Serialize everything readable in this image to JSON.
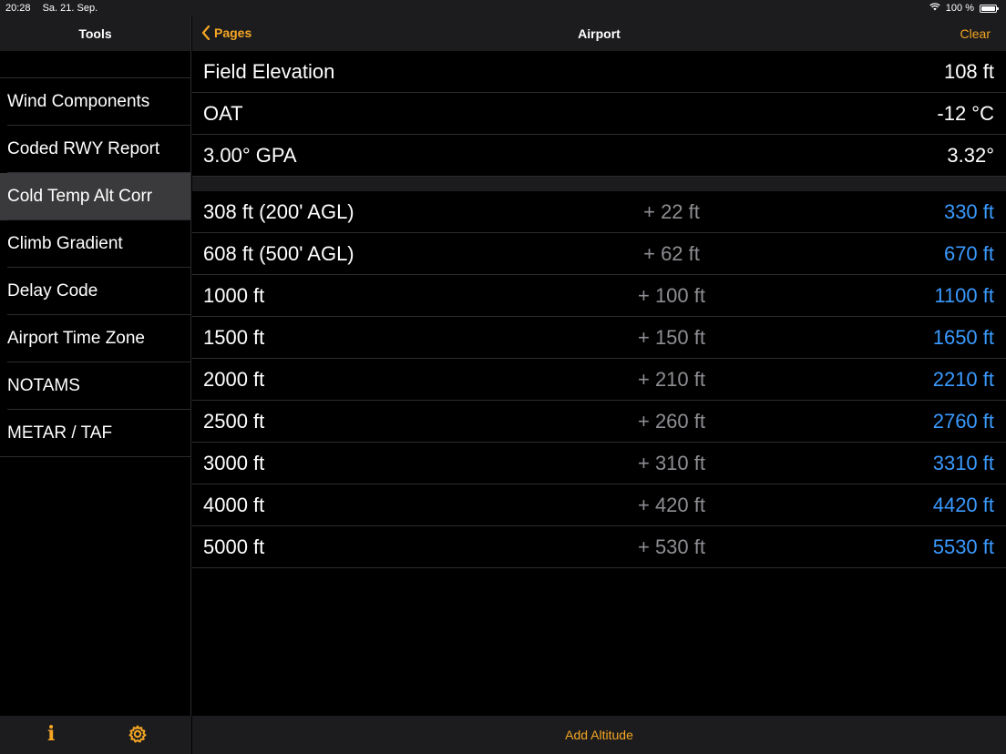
{
  "status": {
    "time": "20:28",
    "date": "Sa. 21. Sep.",
    "battery": "100 %",
    "battery_level": 1.0
  },
  "sidebar": {
    "title": "Tools",
    "items": [
      {
        "label": "Wind Components"
      },
      {
        "label": "Coded RWY Report"
      },
      {
        "label": "Cold Temp Alt Corr"
      },
      {
        "label": "Climb Gradient"
      },
      {
        "label": "Delay Code"
      },
      {
        "label": "Airport Time Zone"
      },
      {
        "label": "NOTAMS"
      },
      {
        "label": "METAR / TAF"
      }
    ],
    "selected_index": 2,
    "footer": {
      "info_icon": "info-icon",
      "settings_icon": "gear-icon"
    }
  },
  "navbar": {
    "back_label": "Pages",
    "title": "Airport",
    "clear_label": "Clear"
  },
  "inputs": [
    {
      "label": "Field Elevation",
      "value": "108 ft"
    },
    {
      "label": "OAT",
      "value": "-12 °C"
    },
    {
      "label": "3.00° GPA",
      "value": "3.32°"
    }
  ],
  "altitudes": [
    {
      "altitude": "308 ft  (200' AGL)",
      "correction": "+ 22 ft",
      "corrected": "330 ft"
    },
    {
      "altitude": "608 ft  (500' AGL)",
      "correction": "+ 62 ft",
      "corrected": "670 ft"
    },
    {
      "altitude": "1000 ft",
      "correction": "+ 100 ft",
      "corrected": "1100 ft"
    },
    {
      "altitude": "1500 ft",
      "correction": "+ 150 ft",
      "corrected": "1650 ft"
    },
    {
      "altitude": "2000 ft",
      "correction": "+ 210 ft",
      "corrected": "2210 ft"
    },
    {
      "altitude": "2500 ft",
      "correction": "+ 260 ft",
      "corrected": "2760 ft"
    },
    {
      "altitude": "3000 ft",
      "correction": "+ 310 ft",
      "corrected": "3310 ft"
    },
    {
      "altitude": "4000 ft",
      "correction": "+ 420 ft",
      "corrected": "4420 ft"
    },
    {
      "altitude": "5000 ft",
      "correction": "+ 530 ft",
      "corrected": "5530 ft"
    }
  ],
  "bottom_bar": {
    "add_label": "Add Altitude"
  },
  "colors": {
    "accent": "#f5a623",
    "result": "#3a9aff",
    "muted": "#8e8e93"
  }
}
